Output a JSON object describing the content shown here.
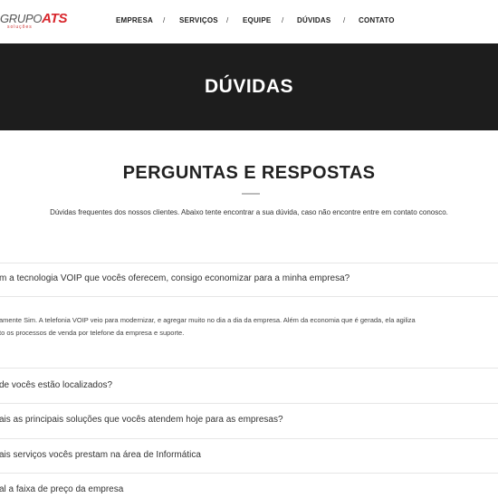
{
  "brand": {
    "name_prefix": "GRUPO",
    "name_brand": "ATS",
    "tagline": "soluções"
  },
  "nav": {
    "items": [
      "EMPRESA",
      "SERVIÇOS",
      "EQUIPE",
      "DÚVIDAS",
      "CONTATO"
    ],
    "separator": "/"
  },
  "hero": {
    "title": "DÚVIDAS"
  },
  "faq": {
    "title": "PERGUNTAS E RESPOSTAS",
    "intro": "Dúvidas frequentes dos nossos clientes. Abaixo tente encontrar a sua dúvida, caso não encontre entre em contato conosco.",
    "items": [
      {
        "question": "m a tecnologia VOIP que vocês oferecem, consigo economizar para a minha empresa?",
        "answer_line1": "amente Sim. A telefonia VOIP veio para modernizar, e agregar muito no dia a dia da empresa. Além da economia que é gerada, ela agiliza",
        "answer_line2": "to os processos de venda por telefone da empresa e suporte."
      },
      {
        "question": "de vocês estão localizados?"
      },
      {
        "question": "ais as principais soluções que vocês atendem hoje para as empresas?"
      },
      {
        "question": "ais serviços vocês prestam na área de Informática"
      },
      {
        "question": "al a faixa de preço da empresa"
      }
    ]
  }
}
